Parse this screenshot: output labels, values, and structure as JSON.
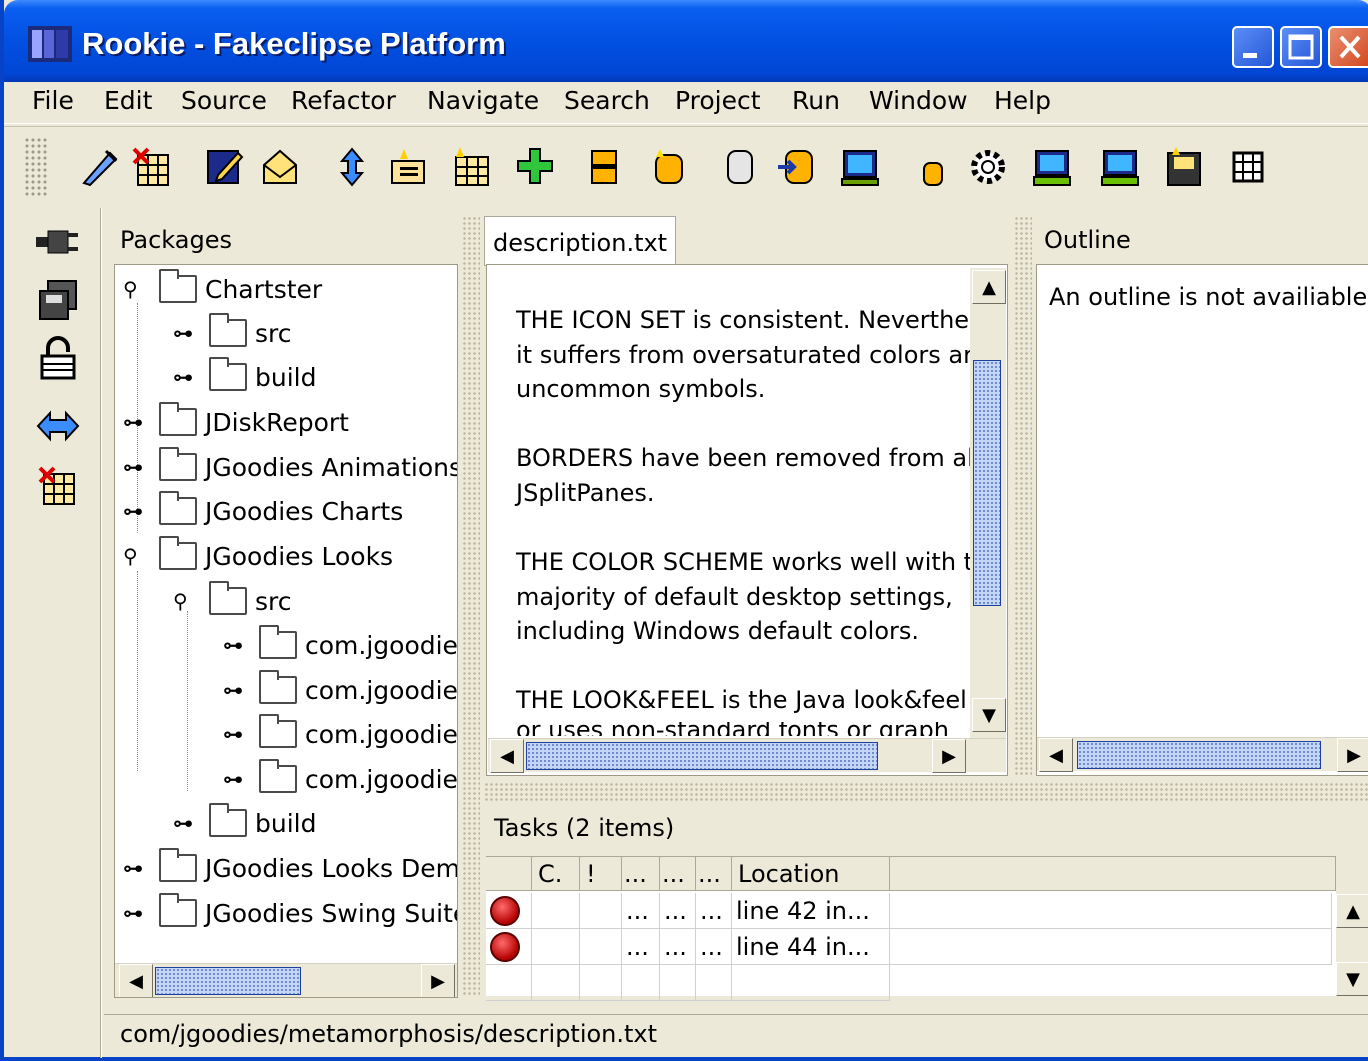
{
  "window": {
    "title": "Rookie - Fakeclipse Platform",
    "colors": {
      "titlebar": "#0250E2",
      "chrome": "#ECE9D8",
      "accent_thumb": "#c4d6f6"
    }
  },
  "menu": [
    "File",
    "Edit",
    "Source",
    "Refactor",
    "Navigate",
    "Search",
    "Project",
    "Run",
    "Window",
    "Help"
  ],
  "toolbar_icons": [
    "pin-icon",
    "table-x-icon",
    "edit-icon",
    "mail-icon",
    "updown-icon",
    "folder-new-icon",
    "table-new-icon",
    "add-icon",
    "split-icon",
    "db-icon",
    "cylinder-icon",
    "db-import-icon",
    "monitor-icon",
    "small-db-icon",
    "gear-icon",
    "monitor-net-icon",
    "monitor-net2-icon",
    "save-star-icon",
    "grid-icon"
  ],
  "side_icons": [
    "plug-icon",
    "save-stack-icon",
    "lock-icon",
    "swap-icon",
    "table-x-icon"
  ],
  "packages": {
    "title": "Packages",
    "items": [
      {
        "label": "Chartster",
        "expanded": true
      },
      {
        "label": "src"
      },
      {
        "label": "build"
      },
      {
        "label": "JDiskReport"
      },
      {
        "label": "JGoodies Animations"
      },
      {
        "label": "JGoodies Charts"
      },
      {
        "label": "JGoodies Looks",
        "expanded": true
      },
      {
        "label": "src",
        "expanded": true
      },
      {
        "label": "com.jgoodies.looks"
      },
      {
        "label": "com.jgoodies.looks"
      },
      {
        "label": "com.jgoodies.looks"
      },
      {
        "label": "com.jgoodies.looks"
      },
      {
        "label": "build"
      },
      {
        "label": "JGoodies Looks Demo"
      },
      {
        "label": "JGoodies Swing Suite"
      }
    ]
  },
  "editor": {
    "tab": "description.txt",
    "lines": [
      "THE ICON SET is consistent. Neverthe",
      "it suffers from oversaturated colors ar",
      "uncommon symbols.",
      "BORDERS have been removed from all",
      "JSplitPanes.",
      "THE COLOR SCHEME works well with th",
      "majority of default desktop settings,",
      "including Windows default colors.",
      "THE LOOK&FEEL is the Java look&feel",
      "or uses non-standard fonts or graph"
    ]
  },
  "outline": {
    "title": "Outline",
    "message": "An outline is not availiable."
  },
  "tasks": {
    "title": "Tasks (2 items)",
    "columns": [
      "",
      "C.",
      "!",
      "...",
      "...",
      "...",
      "Location"
    ],
    "rows": [
      {
        "c1": "...",
        "c2": "...",
        "c3": "...",
        "location": "line 42 in..."
      },
      {
        "c1": "...",
        "c2": "...",
        "c3": "...",
        "location": "line 44 in..."
      }
    ]
  },
  "status": {
    "path": "com/jgoodies/metamorphosis/description.txt"
  }
}
